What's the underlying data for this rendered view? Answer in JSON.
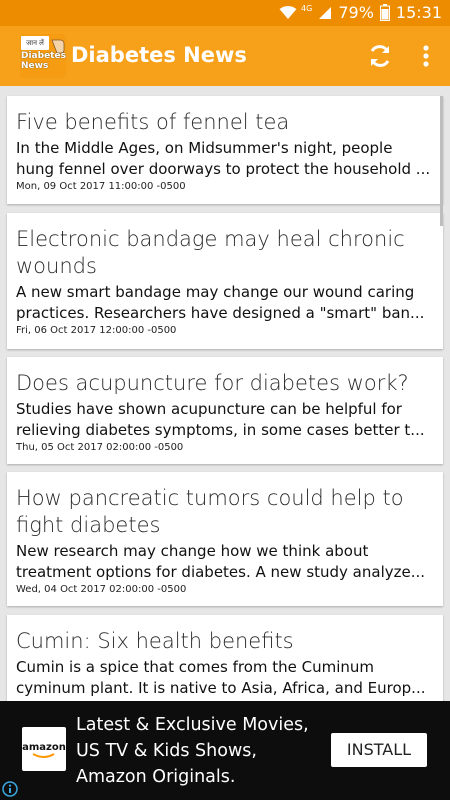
{
  "status_bar": {
    "network": "4G",
    "battery": "79%",
    "time": "15:31",
    "icons": [
      "wifi-icon",
      "signal-icon",
      "battery-icon"
    ]
  },
  "app_bar": {
    "title": "Diabetes News",
    "logo_top_text": "जान लें",
    "logo_text": "Diabetes News",
    "actions": [
      "refresh-icon",
      "more-vert-icon"
    ],
    "color": "#f7a11a"
  },
  "articles": [
    {
      "title": "Five benefits of fennel tea",
      "summary": [
        "In the Middle Ages, on Midsummer's night, people",
        "hung fennel over doorways to protect the household ..."
      ],
      "date": "Mon, 09 Oct 2017 11:00:00 -0500"
    },
    {
      "title": "Electronic bandage may heal chronic wounds",
      "summary": [
        "A new smart bandage may change our wound caring",
        "practices.  Researchers have designed a \"smart\" ban..."
      ],
      "date": "Fri, 06 Oct 2017 12:00:00 -0500"
    },
    {
      "title": "Does acupuncture for diabetes work?",
      "summary": [
        "Studies have shown acupuncture can be helpful for",
        "relieving diabetes symptoms, in some cases better t..."
      ],
      "date": "Thu, 05 Oct 2017 02:00:00 -0500"
    },
    {
      "title": "How pancreatic tumors could help to fight diabetes",
      "summary": [
        "New research may change how we think about",
        "treatment options for diabetes.  A new study analyze..."
      ],
      "date": "Wed, 04 Oct 2017 02:00:00 -0500"
    },
    {
      "title": "Cumin: Six health benefits",
      "summary": [
        "Cumin is a spice that comes from the Cuminum",
        "cyminum plant. It is native to Asia, Africa, and Europ..."
      ],
      "date": ""
    }
  ],
  "ad": {
    "brand": "amazon",
    "text_lines": [
      "Latest & Exclusive Movies,",
      "US TV & Kids Shows,",
      "Amazon Originals."
    ],
    "button": "INSTALL",
    "icons": [
      "adchoices-icon"
    ]
  }
}
